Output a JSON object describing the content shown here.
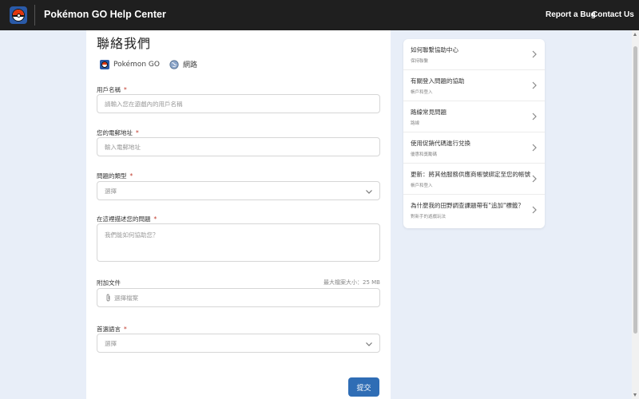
{
  "header": {
    "title": "Pokémon GO Help Center",
    "nav": {
      "report_bug": "Report a Bug",
      "contact_us": "Contact Us"
    },
    "background_color": "#1f1f1f"
  },
  "form": {
    "title": "聯絡我們",
    "product": "Pokémon GO",
    "platform": "網路",
    "fields": {
      "username": {
        "label": "用戶名稱",
        "required_mark": "*",
        "placeholder": "請輸入您在遊戲內的用戶名稱"
      },
      "email": {
        "label": "您的電郵地址",
        "required_mark": "*",
        "placeholder": "輸入電郵地址"
      },
      "issue_type": {
        "label": "問題的類型",
        "required_mark": "*",
        "selected": "選擇"
      },
      "description": {
        "label": "在這裡描述您的問題",
        "required_mark": "*",
        "placeholder": "我們能如何協助您？"
      },
      "attachment": {
        "label": "附加文件",
        "max_size": "最大檔案大小：25 MB",
        "button_label": "選擇檔案"
      },
      "language": {
        "label": "首選語言",
        "required_mark": "*",
        "selected": "選擇"
      }
    },
    "submit_label": "提交",
    "submit_color": "#2f6db5"
  },
  "sidebar": {
    "items": [
      {
        "title": "如何聯繫協助中心",
        "subtitle": "保持聯繫"
      },
      {
        "title": "有關登入問題的協助",
        "subtitle": "帳戶和登入"
      },
      {
        "title": "路線常見問題",
        "subtitle": "路線"
      },
      {
        "title": "使用促銷代碼進行兌換",
        "subtitle": "優惠和獎勵碼"
      },
      {
        "title": "更新：將其他服務供應商帳號綁定至您的帳號",
        "subtitle": "帳戶和登入"
      },
      {
        "title": "為什麼我的田野調查課題帶有\"追加\"標籤？",
        "subtitle": "對新手的遊戲玩法"
      }
    ]
  },
  "colors": {
    "page_background": "#e8eef8",
    "accent": "#2f6db5",
    "required": "#c0392b"
  }
}
